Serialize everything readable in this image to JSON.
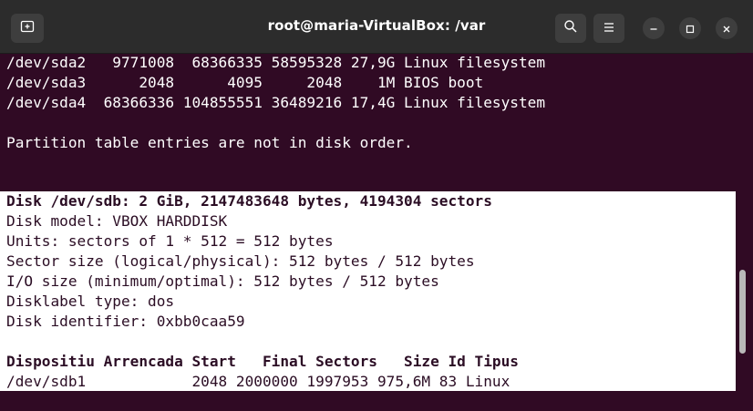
{
  "window": {
    "title": "root@maria-VirtualBox: /var"
  },
  "icons": {
    "new_tab": "new-tab-icon",
    "search": "search-icon",
    "menu": "hamburger-menu-icon",
    "minimize": "minimize-icon",
    "maximize": "maximize-icon",
    "close": "close-icon"
  },
  "colors": {
    "terminal_bg": "#300a24",
    "titlebar_bg": "#2c2c2c",
    "text": "#ffffff",
    "selection_bg": "#ffffff",
    "selection_text": "#2b0d24"
  },
  "terminal": {
    "lines": [
      "/dev/sda2   9771008  68366335 58595328 27,9G Linux filesystem",
      "/dev/sda3      2048      4095     2048    1M BIOS boot",
      "/dev/sda4  68366336 104855551 36489216 17,4G Linux filesystem",
      "",
      "Partition table entries are not in disk order.",
      "",
      "",
      "Disk /dev/sdb: 2 GiB, 2147483648 bytes, 4194304 sectors",
      "Disk model: VBOX HARDDISK",
      "Units: sectors of 1 * 512 = 512 bytes",
      "Sector size (logical/physical): 512 bytes / 512 bytes",
      "I/O size (minimum/optimal): 512 bytes / 512 bytes",
      "Disklabel type: dos",
      "Disk identifier: 0xbb0caa59",
      "",
      "Dispositiu Arrencada Start   Final Sectors   Size Id Tipus",
      "/dev/sdb1            2048 2000000 1997953 975,6M 83 Linux"
    ]
  }
}
